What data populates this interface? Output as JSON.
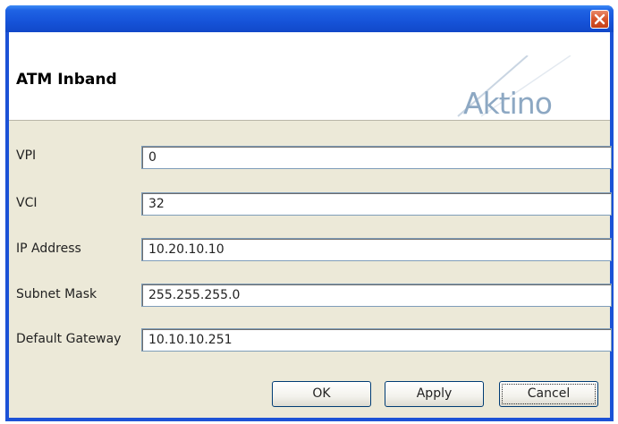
{
  "window": {
    "title": ""
  },
  "header": {
    "title": "ATM Inband",
    "logo_text": "Aktino"
  },
  "fields": [
    {
      "label": "VPI",
      "value": "0"
    },
    {
      "label": "VCI",
      "value": "32"
    },
    {
      "label": "IP Address",
      "value": "10.20.10.10"
    },
    {
      "label": "Subnet Mask",
      "value": "255.255.255.0"
    },
    {
      "label": "Default Gateway",
      "value": "10.10.10.251"
    }
  ],
  "buttons": {
    "ok": "OK",
    "apply": "Apply",
    "cancel": "Cancel"
  },
  "colors": {
    "titlebar": "#1653d9",
    "close_button": "#d9582e",
    "dialog_background": "#ece9d8",
    "logo": "#8da8c3"
  },
  "icons": {
    "close": "close-x-icon"
  }
}
